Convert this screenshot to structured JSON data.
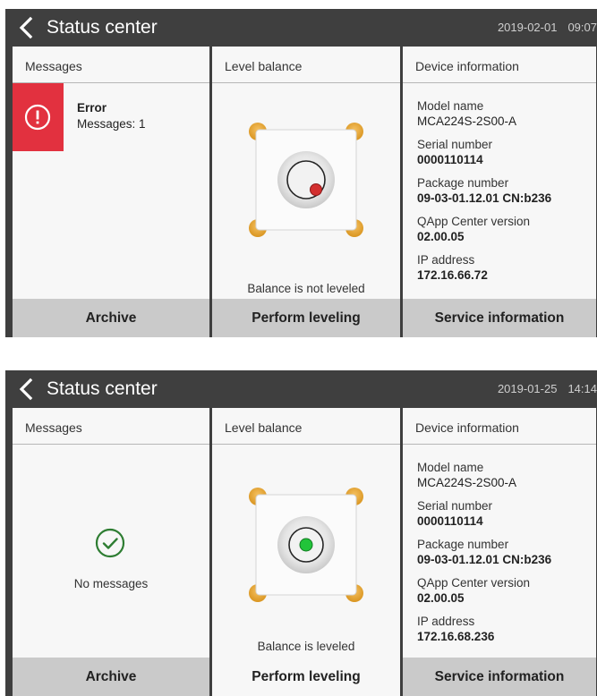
{
  "screens": [
    {
      "title": "Status center",
      "date": "2019-02-01",
      "time": "09:07",
      "messages": {
        "header": "Messages",
        "error_title": "Error",
        "error_count": "Messages: 1",
        "status_color": "#e2313f",
        "footer": "Archive"
      },
      "level": {
        "header": "Level balance",
        "status": "Balance is not leveled",
        "indicator_color": "#d32f2f",
        "footer": "Perform leveling"
      },
      "device": {
        "header": "Device information",
        "items": [
          {
            "label": "Model name",
            "value": "MCA224S-2S00-A"
          },
          {
            "label": "Serial number",
            "value": "0000110114"
          },
          {
            "label": "Package number",
            "value": "09-03-01.12.01 CN:b236"
          },
          {
            "label": "QApp Center version",
            "value": "02.00.05"
          },
          {
            "label": "IP address",
            "value": "172.16.66.72"
          }
        ],
        "footer": "Service information"
      }
    },
    {
      "title": "Status center",
      "date": "2019-01-25",
      "time": "14:14",
      "messages": {
        "header": "Messages",
        "status_text": "No messages",
        "status_color": "#2e7d32",
        "footer": "Archive"
      },
      "level": {
        "header": "Level balance",
        "status": "Balance is leveled",
        "indicator_color": "#22c43a",
        "footer": "Perform leveling"
      },
      "device": {
        "header": "Device information",
        "items": [
          {
            "label": "Model name",
            "value": "MCA224S-2S00-A"
          },
          {
            "label": "Serial number",
            "value": "0000110114"
          },
          {
            "label": "Package number",
            "value": "09-03-01.12.01 CN:b236"
          },
          {
            "label": "QApp Center version",
            "value": "02.00.05"
          },
          {
            "label": "IP address",
            "value": "172.16.68.236"
          }
        ],
        "footer": "Service information"
      }
    }
  ],
  "colors": {
    "titlebar_bg": "#3f3f3f",
    "panel_bg": "#f7f7f7",
    "footer_gray": "#cacaca",
    "corner_pad": "#e8a93a"
  }
}
